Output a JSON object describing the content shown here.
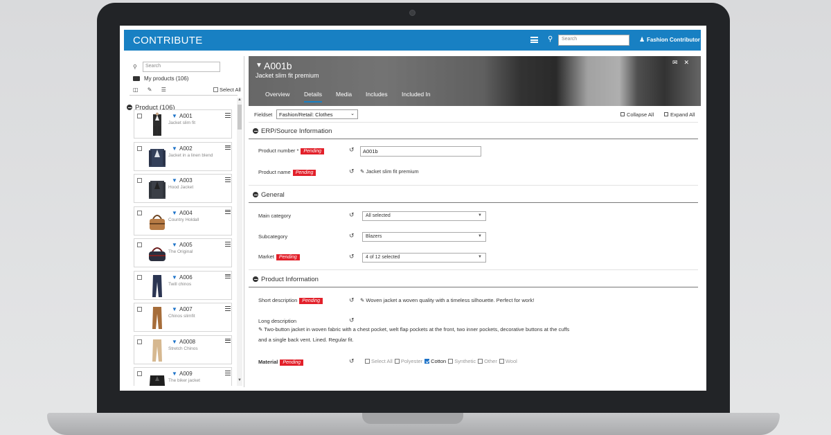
{
  "header": {
    "brand": "CONTRIBUTE",
    "search_placeholder": "Search",
    "user_name": "Fashion Contributor"
  },
  "sidebar": {
    "search_placeholder": "Search",
    "my_products": "My products (106)",
    "select_all": "Select All",
    "group_label": "Product (106)",
    "products": [
      {
        "code": "A001",
        "name": "Jacket slim fit",
        "kind": "suit-black"
      },
      {
        "code": "A002",
        "name": "Jacket in a linen blend",
        "kind": "blazer-navy"
      },
      {
        "code": "A003",
        "name": "Hood Jacket",
        "kind": "blazer-dark"
      },
      {
        "code": "A004",
        "name": "Country Holdall",
        "kind": "bag-tan"
      },
      {
        "code": "A005",
        "name": "The Original",
        "kind": "bag-navy"
      },
      {
        "code": "A006",
        "name": "Twill chinos",
        "kind": "pants-navy"
      },
      {
        "code": "A007",
        "name": "Chinos slimfit",
        "kind": "pants-brown"
      },
      {
        "code": "A0008",
        "name": "Stretch Chinos",
        "kind": "pants-beige"
      },
      {
        "code": "A009",
        "name": "The biker jacket",
        "kind": "jacket-black"
      }
    ]
  },
  "product": {
    "code": "A001b",
    "name": "Jacket slim fit premium",
    "tabs": [
      "Overview",
      "Details",
      "Media",
      "Includes",
      "Included In"
    ],
    "active_tab": "Details"
  },
  "toolbar": {
    "fieldset_label": "Fieldset",
    "fieldset_value": "Fashion/Retail: Clothes",
    "collapse_all": "Collapse All",
    "expand_all": "Expand All"
  },
  "sections": {
    "erp": {
      "title": "ERP/Source Information",
      "product_number_label": "Product number *",
      "product_number_value": "A001b",
      "product_name_label": "Product name",
      "product_name_value": "Jacket slim fit premium"
    },
    "general": {
      "title": "General",
      "main_category_label": "Main category",
      "main_category_value": "All selected",
      "subcategory_label": "Subcategory",
      "subcategory_value": "Blazers",
      "market_label": "Market",
      "market_value": "4 of 12 selected"
    },
    "info": {
      "title": "Product Information",
      "short_desc_label": "Short description",
      "short_desc_value": "Woven jacket a woven quality with a timeless silhouette. Perfect for work!",
      "long_desc_label": "Long description",
      "long_desc_line1": "Two-button jacket in woven fabric with a chest pocket, welt flap pockets at the front, two inner pockets, decorative buttons at the cuffs",
      "long_desc_line2": "and a single back vent. Lined. Regular fit.",
      "material_label": "Material",
      "material_options": [
        "Select All",
        "Polyester",
        "Cotton",
        "Synthetic",
        "Other",
        "Wool"
      ],
      "material_checked": "Cotton"
    }
  },
  "status": {
    "pending": "Pending"
  },
  "colors": {
    "header_blue": "#1880c3",
    "pending_red": "#e2202a",
    "tag_blue": "#1e73c8"
  }
}
